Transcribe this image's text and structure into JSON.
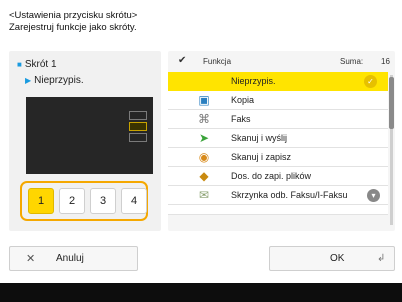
{
  "header": {
    "line1": "<Ustawienia przycisku skrótu>",
    "line2": "Zarejestruj funkcje jako skróty."
  },
  "left": {
    "slot_title": "Skrót 1",
    "slot_value": "Nieprzypis.",
    "buttons": [
      "1",
      "2",
      "3",
      "4"
    ],
    "active_index": 0
  },
  "list": {
    "col_function": "Funkcja",
    "col_sum": "Suma:",
    "count": "16",
    "items": [
      {
        "label": "Nieprzypis.",
        "icon": "none",
        "selected": true
      },
      {
        "label": "Kopia",
        "icon": "copy-icon"
      },
      {
        "label": "Faks",
        "icon": "fax-icon"
      },
      {
        "label": "Skanuj i wyślij",
        "icon": "scan-send-icon"
      },
      {
        "label": "Skanuj i zapisz",
        "icon": "scan-store-icon"
      },
      {
        "label": "Dos. do zapi. plików",
        "icon": "file-access-icon"
      },
      {
        "label": "Skrzynka odb. Faksu/I-Faksu",
        "icon": "fax-inbox-icon"
      }
    ]
  },
  "footer": {
    "cancel_label": "Anuluj",
    "ok_label": "OK"
  },
  "colors": {
    "accent": "#ffe400",
    "group_border": "#f5a800",
    "scroll_thumb": "#8a8a8a"
  }
}
